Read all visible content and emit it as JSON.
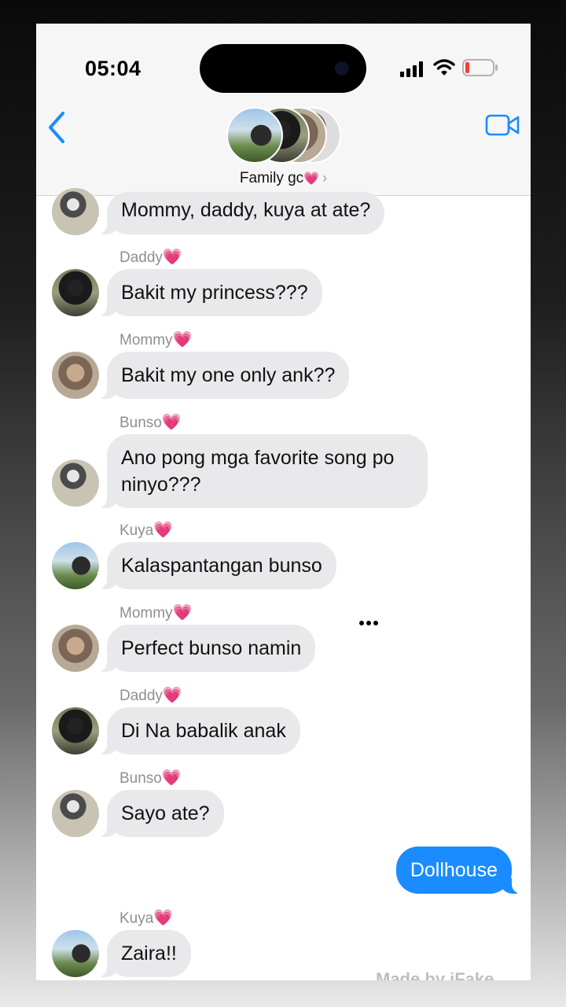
{
  "status_bar": {
    "time": "05:04"
  },
  "header": {
    "group_name": "Family gc",
    "group_emoji": "💗",
    "back_icon": "chevron-left-icon",
    "video_icon": "video-camera-icon"
  },
  "colors": {
    "accent": "#1a8cff",
    "incoming_bubble": "#e9e9eb",
    "sender_label": "#8e8e93"
  },
  "messages": [
    {
      "text": "Mommy, daddy, kuya at ate?"
    },
    {
      "sender": "Daddy",
      "emoji": "💗",
      "text": "Bakit my princess???"
    },
    {
      "sender": "Mommy",
      "emoji": "💗",
      "text": "Bakit my one only ank??"
    },
    {
      "sender": "Bunso",
      "emoji": "💗",
      "text": "Ano pong mga favorite song po ninyo???"
    },
    {
      "sender": "Kuya",
      "emoji": "💗",
      "text": "Kalaspantangan bunso"
    },
    {
      "sender": "Mommy",
      "emoji": "💗",
      "text": "Perfect bunso namin"
    },
    {
      "sender": "Daddy",
      "emoji": "💗",
      "text": "Di Na babalik anak"
    },
    {
      "sender": "Bunso",
      "emoji": "💗",
      "text": "Sayo ate?"
    },
    {
      "text": "Dollhouse",
      "outgoing": true
    },
    {
      "sender": "Kuya",
      "emoji": "💗",
      "text": "Zaira!!"
    }
  ],
  "watermark": "Made by iFake"
}
